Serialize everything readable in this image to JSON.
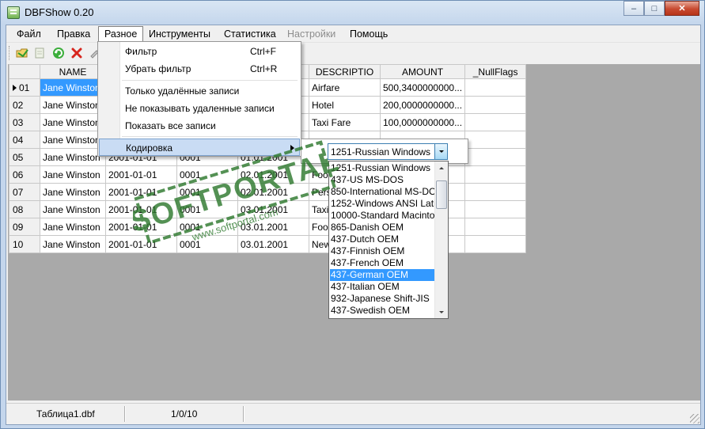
{
  "window": {
    "title": "DBFShow 0.20"
  },
  "menubar": [
    {
      "label": "Файл",
      "state": "normal"
    },
    {
      "label": "Правка",
      "state": "normal"
    },
    {
      "label": "Разное",
      "state": "open"
    },
    {
      "label": "Инструменты",
      "state": "normal"
    },
    {
      "label": "Статистика",
      "state": "normal"
    },
    {
      "label": "Настройки",
      "state": "disabled"
    },
    {
      "label": "Помощь",
      "state": "normal"
    }
  ],
  "dropdown": {
    "items": [
      {
        "label": "Фильтр",
        "shortcut": "Ctrl+F"
      },
      {
        "label": "Убрать фильтр",
        "shortcut": "Ctrl+R"
      },
      {
        "label": "Только удалённые записи",
        "shortcut": ""
      },
      {
        "label": "Не показывать удаленные записи",
        "shortcut": ""
      },
      {
        "label": "Показать все записи",
        "shortcut": ""
      },
      {
        "label": "Кодировка",
        "shortcut": ""
      }
    ]
  },
  "encoding": {
    "selected_value": "1251-Russian Windows",
    "options": [
      "1251-Russian Windows",
      "437-US MS-DOS",
      "850-International MS-DOS",
      "1252-Windows ANSI Latin",
      "10000-Standard Macintosh",
      "865-Danish OEM",
      "437-Dutch OEM",
      "437-Finnish OEM",
      "437-French OEM",
      "437-German OEM",
      "437-Italian OEM",
      "932-Japanese Shift-JIS",
      "437-Swedish OEM"
    ],
    "highlighted": "437-German OEM"
  },
  "grid": {
    "columns": [
      "",
      "NAME",
      "",
      "",
      "",
      "DESCRIPTIO",
      "AMOUNT",
      "_NullFlags"
    ],
    "rows": [
      [
        "01",
        "Jane Winston",
        "",
        "",
        "",
        "Airfare",
        "500,3400000000...",
        ""
      ],
      [
        "02",
        "Jane Winston",
        "",
        "",
        "",
        "Hotel",
        "200,0000000000...",
        ""
      ],
      [
        "03",
        "Jane Winston",
        "",
        "",
        "",
        "Taxi Fare",
        "100,0000000000...",
        ""
      ],
      [
        "04",
        "Jane Winston",
        "",
        "",
        "",
        "",
        "",
        ""
      ],
      [
        "05",
        "Jane Winston",
        "2001-01-01",
        "0001",
        "01.01.2001",
        "",
        "",
        ""
      ],
      [
        "06",
        "Jane Winston",
        "2001-01-01",
        "0001",
        "02.01.2001",
        "Food",
        "",
        ""
      ],
      [
        "07",
        "Jane Winston",
        "2001-01-01",
        "0001",
        "02.01.2001",
        "Perso",
        "",
        ""
      ],
      [
        "08",
        "Jane Winston",
        "2001-01-01",
        "0001",
        "03.01.2001",
        "Taxi",
        "",
        ""
      ],
      [
        "09",
        "Jane Winston",
        "2001-01-01",
        "0001",
        "03.01.2001",
        "Food",
        "",
        ""
      ],
      [
        "10",
        "Jane Winston",
        "2001-01-01",
        "0001",
        "03.01.2001",
        "New",
        "",
        ""
      ]
    ],
    "current_row": "01"
  },
  "statusbar": {
    "file": "Таблица1.dbf",
    "position": "1/0/10",
    "extra": ""
  },
  "watermark": {
    "text": "SOFTPORTAL",
    "url": "www.softportal.com"
  },
  "colors": {
    "selection": "#3399ff",
    "menu_highlight": "#c9dcf4",
    "watermark": "#2f7a2f"
  }
}
